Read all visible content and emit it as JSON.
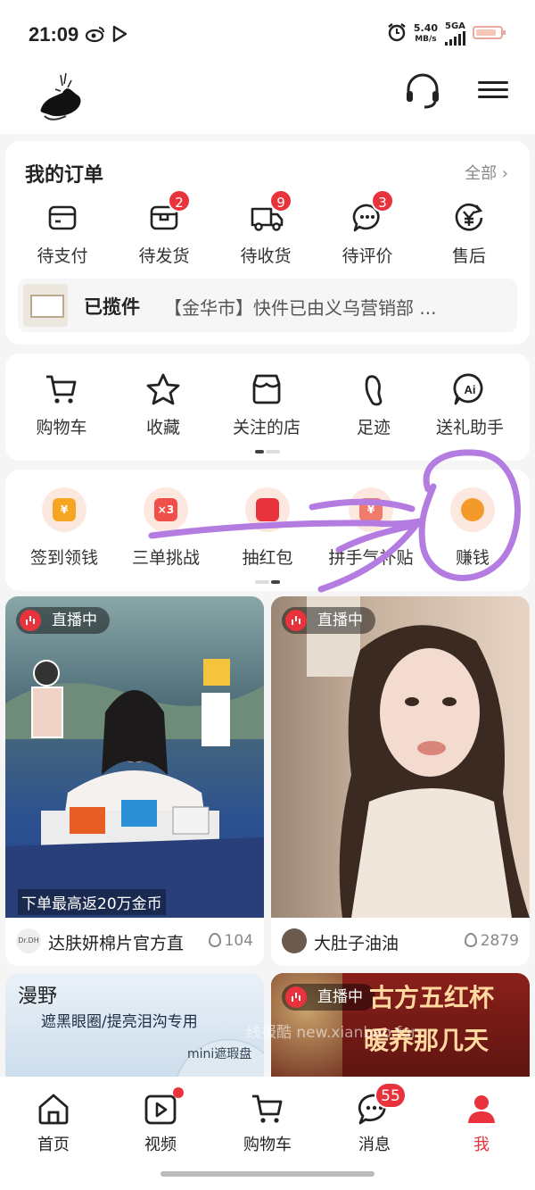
{
  "status_bar": {
    "time": "21:09",
    "net_speed": "5.40",
    "net_unit": "MB/s",
    "network": "5GA",
    "icons": [
      "weibo-icon",
      "play-icon",
      "alarm-icon",
      "signal-icon",
      "battery-icon"
    ]
  },
  "orders": {
    "title": "我的订单",
    "all_label": "全部 ›",
    "items": [
      {
        "label": "待支付",
        "icon": "wallet-icon",
        "badge": ""
      },
      {
        "label": "待发货",
        "icon": "box-icon",
        "badge": "2"
      },
      {
        "label": "待收货",
        "icon": "truck-icon",
        "badge": "9"
      },
      {
        "label": "待评价",
        "icon": "comment-icon",
        "badge": "3"
      },
      {
        "label": "售后",
        "icon": "yen-refund-icon",
        "badge": ""
      }
    ],
    "package": {
      "status": "已揽件",
      "message": "【金华市】快件已由义乌营销部 ..."
    }
  },
  "shortcuts": {
    "items": [
      {
        "label": "购物车",
        "icon": "cart-icon"
      },
      {
        "label": "收藏",
        "icon": "star-icon"
      },
      {
        "label": "关注的店",
        "icon": "store-icon"
      },
      {
        "label": "足迹",
        "icon": "footprint-icon"
      },
      {
        "label": "送礼助手",
        "icon": "ai-icon"
      }
    ]
  },
  "rewards": {
    "items": [
      {
        "label": "签到领钱",
        "icon": "checkin-icon",
        "glyph": "¥"
      },
      {
        "label": "三单挑战",
        "icon": "challenge-icon",
        "glyph": "×3"
      },
      {
        "label": "抽红包",
        "icon": "red-packet-icon",
        "glyph": ""
      },
      {
        "label": "拼手气补贴",
        "icon": "subsidy-icon",
        "glyph": "¥"
      },
      {
        "label": "赚钱",
        "icon": "money-bag-icon",
        "glyph": ""
      }
    ]
  },
  "feed": {
    "live_label": "直播中",
    "cards": [
      {
        "shop": "达肤妍棉片官方直",
        "likes": "104",
        "promo": "下单最高返20万金币",
        "logo_text": "Dr.DH"
      },
      {
        "shop": "大肚子油油",
        "likes": "2879",
        "promo": "",
        "logo_text": ""
      },
      {
        "shop": "",
        "likes": "",
        "promo": "",
        "top_text": "漫野",
        "sub_text": "遮黑眼圈/提亮泪沟专用",
        "product_text": "mini遮瑕盘"
      },
      {
        "shop": "",
        "likes": "",
        "promo": "",
        "top_text": "古方五红杯",
        "sub_text": "暖养那几天"
      }
    ]
  },
  "watermark": "线报酷 new.xianbao.fun",
  "tabbar": {
    "items": [
      {
        "label": "首页",
        "icon": "home-icon",
        "badge": ""
      },
      {
        "label": "视频",
        "icon": "video-icon",
        "badge": "dot"
      },
      {
        "label": "购物车",
        "icon": "cart-icon",
        "badge": ""
      },
      {
        "label": "消息",
        "icon": "message-icon",
        "badge": "55"
      },
      {
        "label": "我",
        "icon": "profile-icon",
        "badge": ""
      }
    ]
  },
  "colors": {
    "accent": "#e8323c",
    "annotation": "#b47be0"
  }
}
